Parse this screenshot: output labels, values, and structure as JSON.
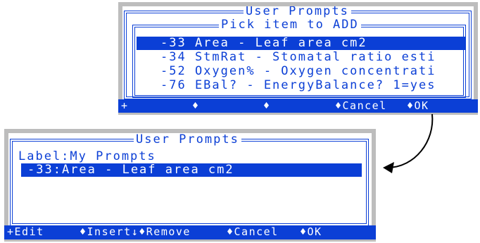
{
  "top_screen": {
    "outer_title": "User Prompts",
    "inner_title": "Pick item to ADD",
    "items": [
      "-33 Area - Leaf area cm2",
      "-34 StmRat - Stomatal ratio esti",
      "-52 Oxygen% - Oxygen concentrati",
      "-76 EBal? - EnergyBalance? 1=yes"
    ],
    "selected_index": 0,
    "fkeys": [
      "+",
      "♦",
      "♦",
      "♦Cancel",
      "♦OK"
    ]
  },
  "bottom_screen": {
    "title": "User Prompts",
    "label_line": "Label:My Prompts",
    "items": [
      "-33:Area - Leaf area cm2"
    ],
    "selected_index": 0,
    "fkeys": [
      "+Edit",
      "♦Insert↓♦Remove",
      "♦Cancel",
      "♦OK"
    ]
  },
  "colors": {
    "accent": "#0b3fd6",
    "frame": "#bdbdbd",
    "background": "#ffffff"
  }
}
